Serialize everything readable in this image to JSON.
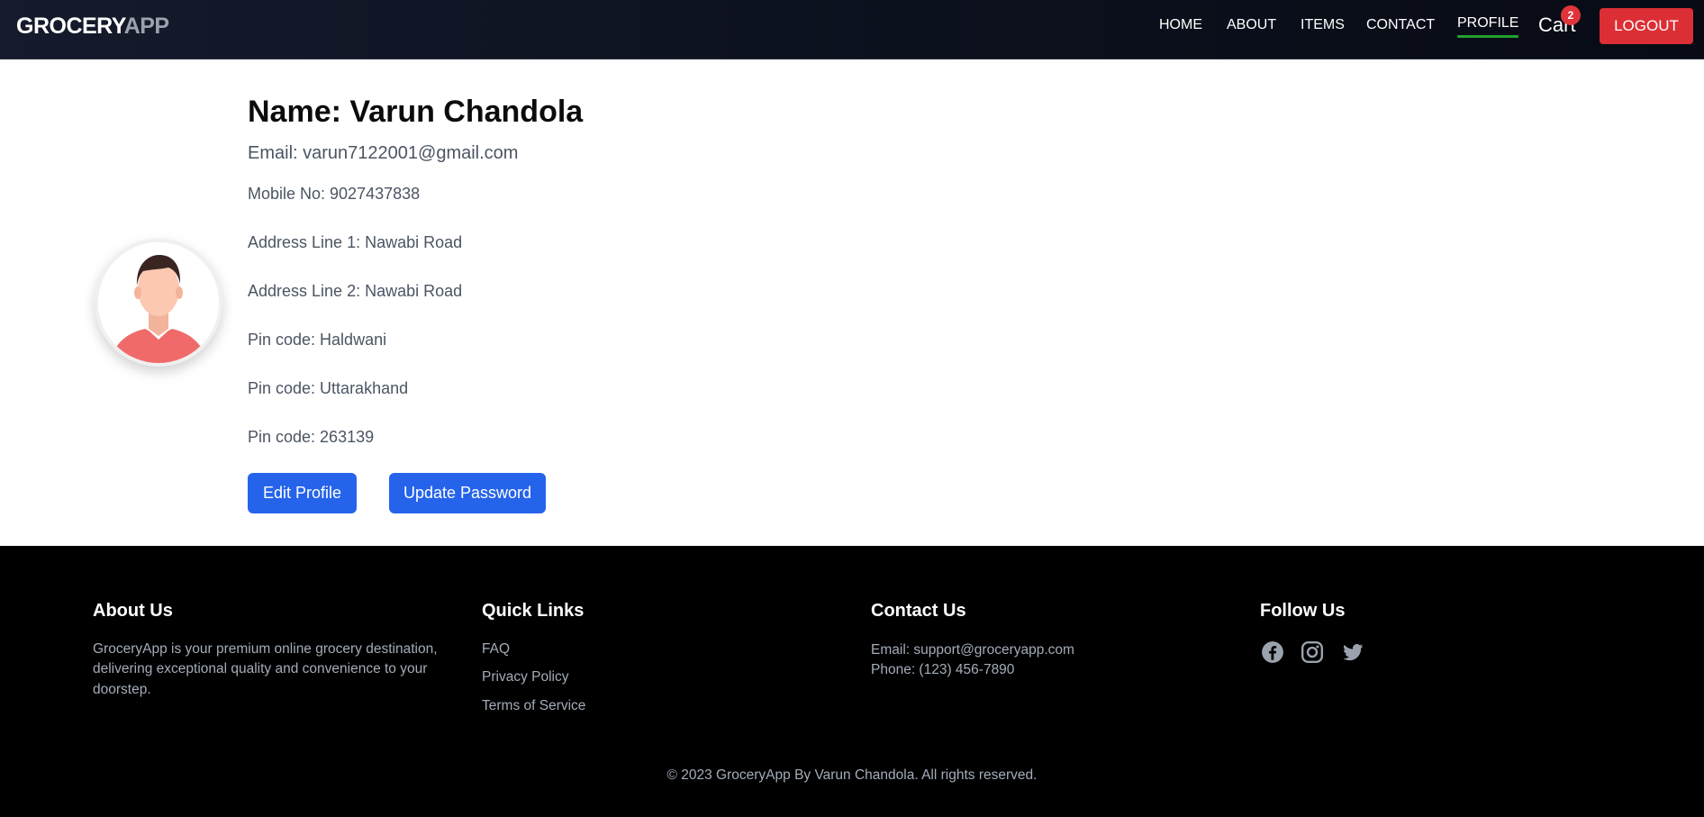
{
  "brand": {
    "part1": "GROCERY",
    "part2": "APP"
  },
  "nav": {
    "items": [
      {
        "label": "HOME"
      },
      {
        "label": "ABOUT"
      },
      {
        "label": "ITEMS"
      },
      {
        "label": "CONTACT"
      },
      {
        "label": "PROFILE",
        "active": true
      }
    ],
    "cart_label": "Cart",
    "cart_count": "2",
    "logout_label": "LOGOUT"
  },
  "profile": {
    "name": "Name: Varun Chandola",
    "email": "Email: varun7122001@gmail.com",
    "lines": [
      "Mobile No: 9027437838",
      "Address Line 1: Nawabi Road",
      "Address Line 2: Nawabi Road",
      "Pin code: Haldwani",
      "Pin code: Uttarakhand",
      "Pin code: 263139"
    ],
    "edit_button": "Edit Profile",
    "password_button": "Update Password"
  },
  "footer": {
    "about": {
      "title": "About Us",
      "lines": [
        "GroceryApp is your premium online grocery destination,",
        "delivering exceptional quality and convenience to your",
        "doorstep."
      ]
    },
    "quick_links": {
      "title": "Quick Links",
      "links": [
        "FAQ",
        "Privacy Policy",
        "Terms of Service"
      ]
    },
    "contact": {
      "title": "Contact Us",
      "email": "Email: support@groceryapp.com",
      "phone": "Phone: (123) 456-7890"
    },
    "follow": {
      "title": "Follow Us",
      "icons": [
        "facebook-icon",
        "instagram-icon",
        "twitter-icon"
      ]
    },
    "copyright": "© 2023 GroceryApp By Varun Chandola. All rights reserved."
  },
  "colors": {
    "nav_bg": "#0d1220",
    "active_underline": "#22a02c",
    "logout": "#dc2f35",
    "badge": "#e0343b",
    "primary_button": "#2563eb",
    "footer_bg": "#000000"
  }
}
